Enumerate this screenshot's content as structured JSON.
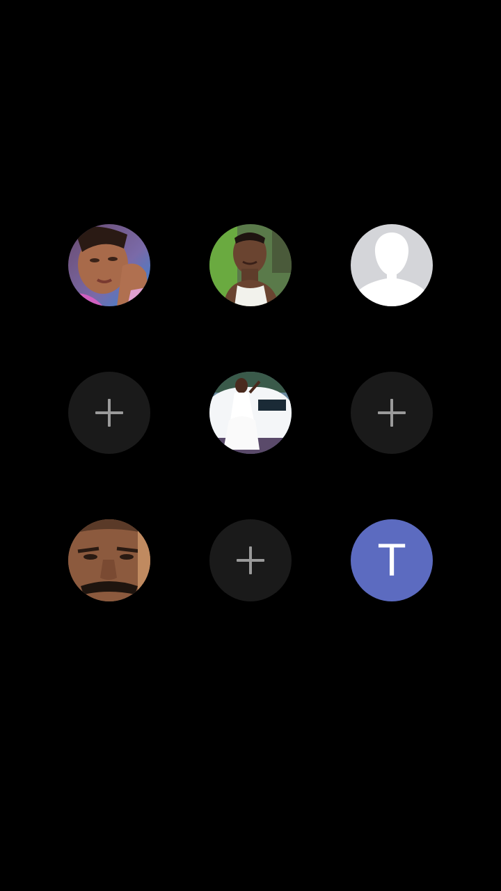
{
  "contacts": [
    {
      "row": 1,
      "col": 1,
      "type": "photo",
      "icon": "woman-selfie-photo"
    },
    {
      "row": 1,
      "col": 2,
      "type": "photo",
      "icon": "man-selfie-photo"
    },
    {
      "row": 1,
      "col": 3,
      "type": "placeholder",
      "icon": "default-person-avatar-icon"
    },
    {
      "row": 2,
      "col": 1,
      "type": "add",
      "icon": "plus-icon"
    },
    {
      "row": 2,
      "col": 2,
      "type": "photo",
      "icon": "girl-white-dress-car-photo"
    },
    {
      "row": 2,
      "col": 3,
      "type": "add",
      "icon": "plus-icon"
    },
    {
      "row": 3,
      "col": 1,
      "type": "photo",
      "icon": "man-closeup-photo"
    },
    {
      "row": 3,
      "col": 2,
      "type": "add",
      "icon": "plus-icon"
    },
    {
      "row": 3,
      "col": 3,
      "type": "letter",
      "letter": "T",
      "color": "#5c6bc0"
    }
  ],
  "colors": {
    "background": "#000000",
    "empty_slot": "#1a1a1a",
    "plus": "#9a9a9a",
    "letter_avatar": "#5c6bc0"
  }
}
